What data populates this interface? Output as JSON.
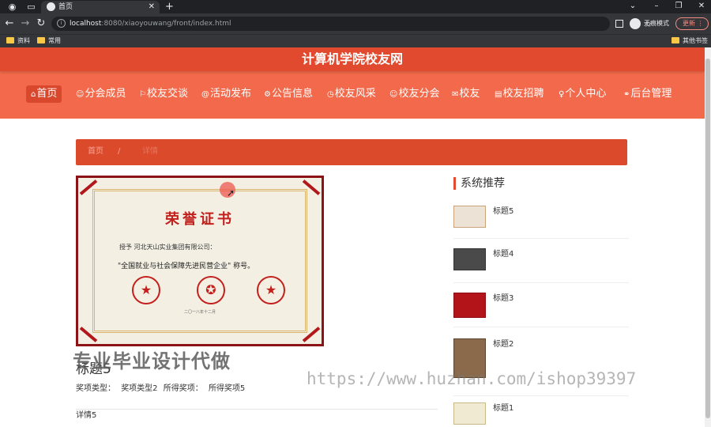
{
  "browser": {
    "tab_title": "首页",
    "url_host": "localhost",
    "url_rest": ":8080/xiaoyouwang/front/index.html",
    "profile_label": "无痕模式",
    "update_label": "更新",
    "bookmarks": [
      "资料",
      "常用"
    ],
    "bookmarks_right": "其他书签"
  },
  "site": {
    "title": "计算机学院校友网",
    "nav": [
      {
        "label": "首页",
        "icon": "home-icon"
      },
      {
        "label": "分会成员",
        "icon": "members-icon"
      },
      {
        "label": "校友交谈",
        "icon": "chat-icon"
      },
      {
        "label": "活动发布",
        "icon": "activity-icon"
      },
      {
        "label": "公告信息",
        "icon": "notice-icon"
      },
      {
        "label": "校友风采",
        "icon": "style-icon"
      },
      {
        "label": "校友分会",
        "icon": "branch-icon"
      },
      {
        "label": "校友",
        "icon": "alumni-icon"
      },
      {
        "label": "校友招聘",
        "icon": "recruit-icon"
      },
      {
        "label": "个人中心",
        "icon": "user-icon"
      },
      {
        "label": "后台管理",
        "icon": "link-icon"
      }
    ],
    "nav_icon_glyphs": [
      "⌂",
      "☺",
      "⚐",
      "@",
      "⚙",
      "◷",
      "☺",
      "✉",
      "▤",
      "♀",
      "⚭"
    ]
  },
  "breadcrumb": {
    "home": "首页",
    "separator": "/",
    "current": "详情"
  },
  "detail": {
    "certificate": {
      "heading": "荣誉证书",
      "line1": "授予  河北天山实业集团有限公司：",
      "line2": "\"全国就业与社会保障先进民营企业\" 称号。",
      "date": "二〇一八年十二月"
    },
    "title": "标题5",
    "award_type_label": "奖项类型：",
    "award_type_value": "奖项类型2",
    "award_label": "所得奖项：",
    "award_value": "所得奖项5",
    "body": "详情5"
  },
  "recommend": {
    "heading": "系统推荐",
    "items": [
      {
        "title": "标题5"
      },
      {
        "title": "标题4"
      },
      {
        "title": "标题3"
      },
      {
        "title": "标题2"
      },
      {
        "title": "标题1"
      }
    ]
  },
  "watermarks": {
    "left": "专业毕业设计代做",
    "right": "https://www.huzhan.com/ishop39397"
  },
  "colors": {
    "header": "#f26a4b",
    "title_bar": "#e14a2e",
    "breadcrumb": "#dc4a2c",
    "accent": "#e24b2f"
  }
}
